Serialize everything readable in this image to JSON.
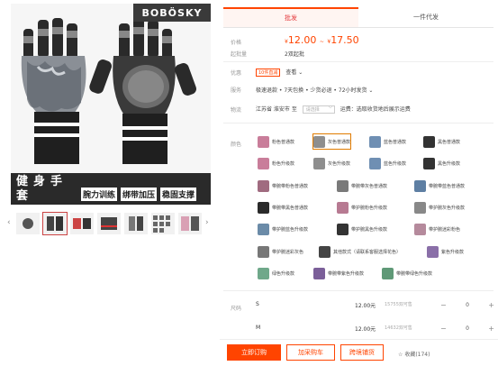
{
  "left": {
    "brand": "BOBÖSKY",
    "banner_title": "健身手套",
    "banner_tags": [
      "腕力训练",
      "绑带加压",
      "稳固支撑"
    ]
  },
  "tabs": [
    "批发",
    "一件代发"
  ],
  "price": {
    "label": "价格",
    "currency": "¥",
    "low": "12.00",
    "sep": "~",
    "high": "17.50",
    "moq_label": "起批量",
    "moq": "2双起批"
  },
  "promo": {
    "label": "优惠",
    "coupon": "10件直减",
    "link": "查看 ⌄"
  },
  "service": {
    "label": "服务",
    "text": "极速退款 • 7天包换 • 少货必退 • 72小时发货 ⌄"
  },
  "shipping": {
    "label": "物流",
    "from": "江苏省 淮安市",
    "to": "至",
    "select_placeholder": "请选择",
    "fee": "运费：选取收货地后展示运费"
  },
  "colors": {
    "label": "颜色",
    "items": [
      "粉色普通款",
      "灰色普通款",
      "蓝色普通款",
      "黑色普通款",
      "粉色升级款",
      "灰色升级款",
      "蓝色升级款",
      "黑色升级款",
      "带腕带粉色普通款",
      "带腕带灰色普通款",
      "带腕带蓝色普通款",
      "带腕带黑色普通款",
      "带护腕粉色升级款",
      "带护腕灰色升级款",
      "带护腕蓝色升级款",
      "带护腕黑色升级款",
      "带护腕迷彩粉色",
      "带护腕迷彩灰色",
      "其他款式（请联系客服选择花色）",
      "紫色升级款",
      "绿色升级款",
      "带腕带紫色升级款",
      "带腕带绿色升级款"
    ]
  },
  "sizes": {
    "label": "尺码",
    "rows": [
      {
        "name": "S",
        "price": "12.00元",
        "stock": "15755双可售",
        "qty": "0"
      },
      {
        "name": "M",
        "price": "12.00元",
        "stock": "14632双可售",
        "qty": "0"
      }
    ]
  },
  "actions": {
    "buy": "立即订购",
    "cart": "加采购车",
    "shop": "跨境铺货",
    "fav": "收藏(174)"
  },
  "icons": {
    "prev": "chevron-left-icon",
    "next": "chevron-right-icon",
    "star": "star-icon"
  },
  "theme": {
    "accent": "#ff4400"
  }
}
